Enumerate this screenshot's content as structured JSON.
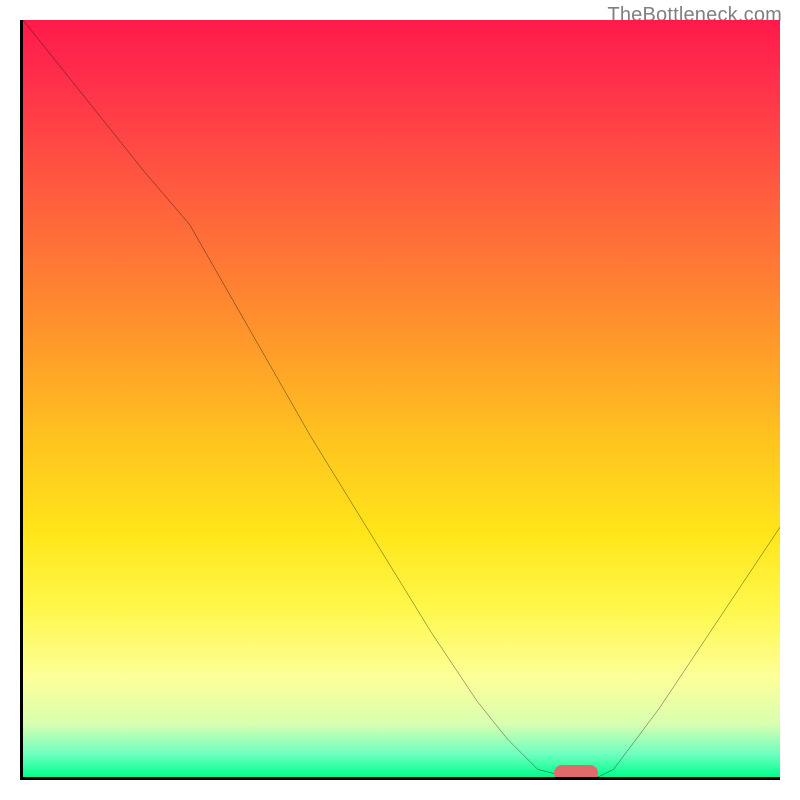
{
  "watermark": "TheBottleneck.com",
  "chart_data": {
    "type": "line",
    "title": "",
    "xlabel": "",
    "ylabel": "",
    "xlim": [
      0,
      100
    ],
    "ylim": [
      0,
      100
    ],
    "grid": false,
    "legend": false,
    "background": {
      "style": "vertical-gradient",
      "stops": [
        {
          "pct": 0,
          "color": "#ff1a4b"
        },
        {
          "pct": 8,
          "color": "#ff2f4b"
        },
        {
          "pct": 22,
          "color": "#ff5a3f"
        },
        {
          "pct": 38,
          "color": "#ff8a2f"
        },
        {
          "pct": 55,
          "color": "#ffc21f"
        },
        {
          "pct": 68,
          "color": "#ffe61a"
        },
        {
          "pct": 78,
          "color": "#fff84d"
        },
        {
          "pct": 87,
          "color": "#fdff9a"
        },
        {
          "pct": 93,
          "color": "#d8ffb0"
        },
        {
          "pct": 97,
          "color": "#6dffc0"
        },
        {
          "pct": 100,
          "color": "#00ff8c"
        }
      ]
    },
    "series": [
      {
        "name": "bottleneck-curve",
        "color": "#000000",
        "x": [
          0,
          8,
          16,
          22,
          30,
          38,
          46,
          54,
          60,
          64,
          68,
          72,
          76,
          78,
          84,
          90,
          96,
          100
        ],
        "y": [
          100,
          90,
          80,
          73,
          59,
          45,
          32,
          19,
          10,
          5,
          1,
          0,
          0,
          1,
          9,
          18,
          27,
          33
        ]
      }
    ],
    "markers": [
      {
        "name": "optimum-marker",
        "x": 73,
        "y": 0.5,
        "shape": "pill",
        "color": "#e26a6a"
      }
    ]
  }
}
